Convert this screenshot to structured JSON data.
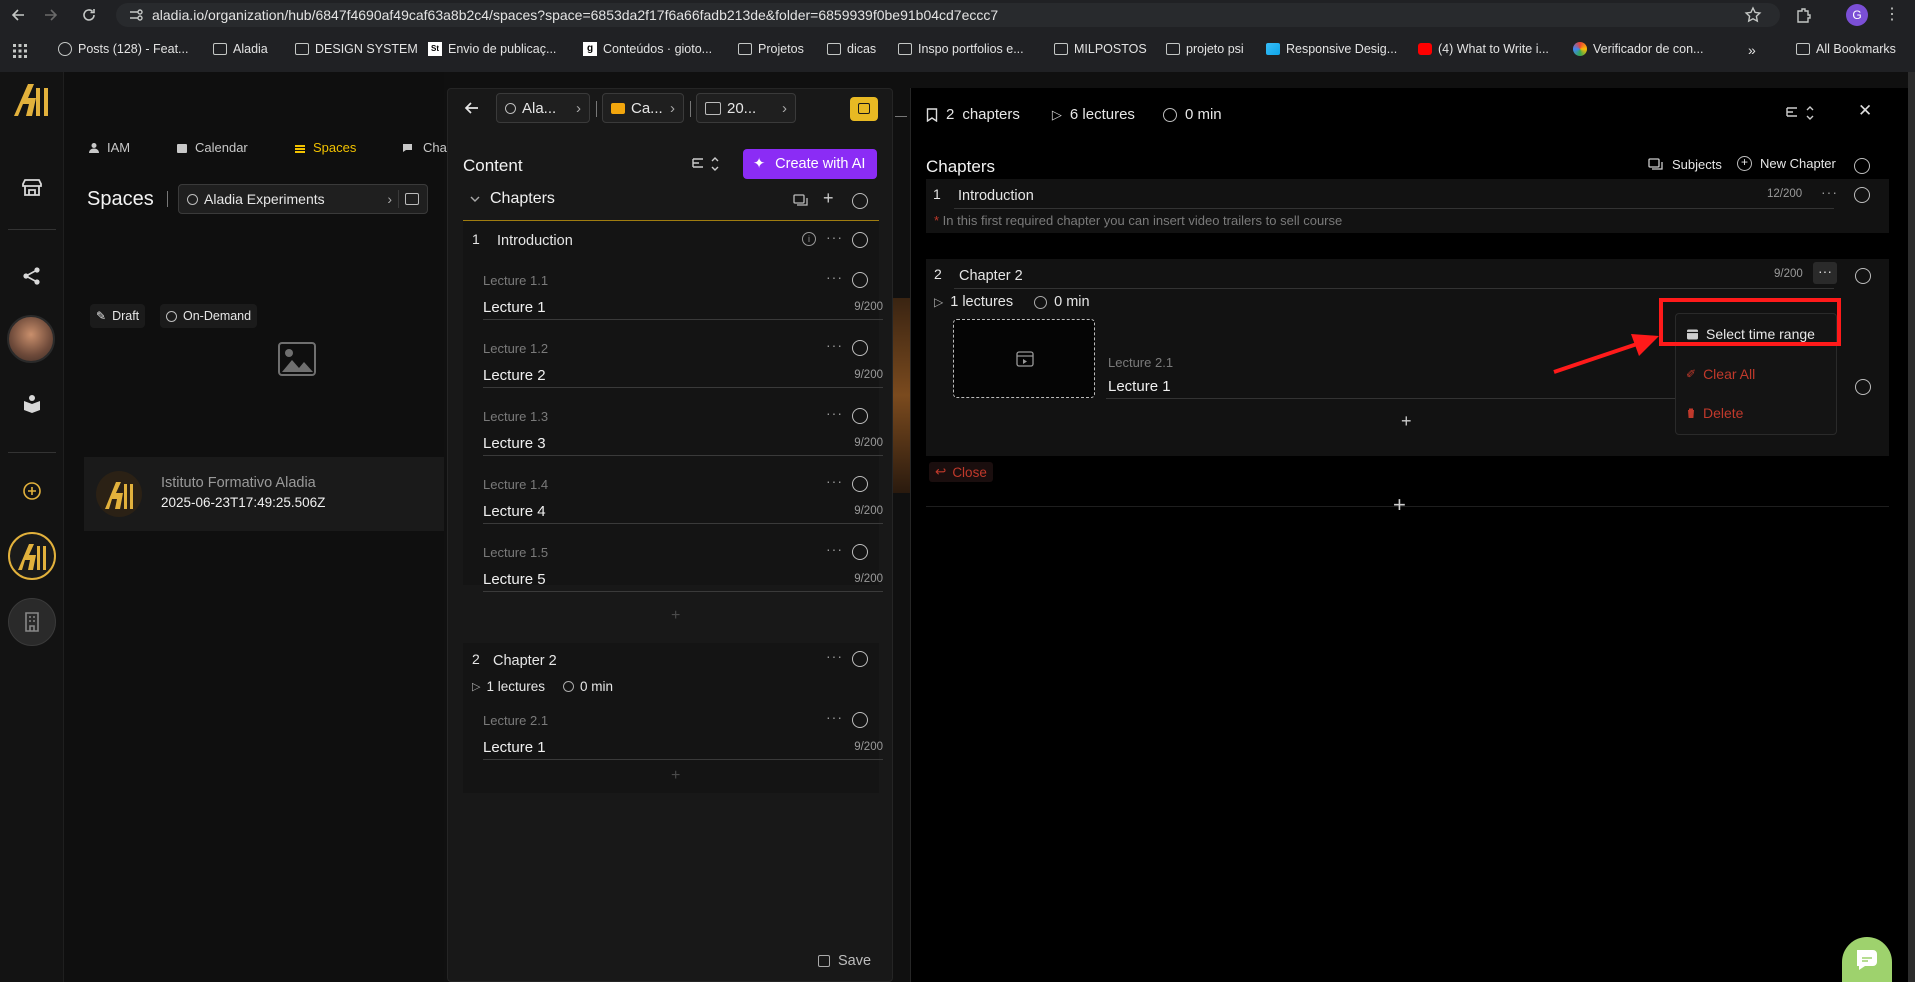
{
  "browser": {
    "url": "aladia.io/organization/hub/6847f4690af49caf63a8b2c4/spaces?space=6853da2f17f6a66fadb213de&folder=6859939f0be91b04cd7eccc7",
    "profile_initial": "G",
    "bookmarks": [
      {
        "label": "Posts (128) - Feat..."
      },
      {
        "label": "Aladia"
      },
      {
        "label": "DESIGN SYSTEM"
      },
      {
        "label": "Envio de publicaç..."
      },
      {
        "label": "Conteúdos · gioto..."
      },
      {
        "label": "Projetos"
      },
      {
        "label": "dicas"
      },
      {
        "label": "Inspo portfolios e..."
      },
      {
        "label": "MILPOSTOS"
      },
      {
        "label": "projeto psi"
      },
      {
        "label": "Responsive Desig..."
      },
      {
        "label": "(4) What to Write i..."
      },
      {
        "label": "Verificador de con..."
      }
    ],
    "more": "»",
    "all_bookmarks": "All Bookmarks"
  },
  "topnav": {
    "tabs": [
      "IAM",
      "Calendar",
      "Spaces",
      "Cha"
    ]
  },
  "spaces": {
    "title": "Spaces",
    "crumb": "Aladia Experiments",
    "badges": [
      "Draft",
      "On-Demand"
    ],
    "org_name": "Istituto Formativo Aladia",
    "org_date": "2025-06-23T17:49:25.506Z"
  },
  "content_panel": {
    "crumbs": [
      "Ala...",
      "Ca...",
      "20..."
    ],
    "title": "Content",
    "create_ai": "Create with AI",
    "chapters_label": "Chapters",
    "chapter1": {
      "num": "1",
      "name": "Introduction",
      "lectures": [
        {
          "sub": "Lecture 1.1",
          "title": "Lecture 1",
          "count": "9/200"
        },
        {
          "sub": "Lecture 1.2",
          "title": "Lecture 2",
          "count": "9/200"
        },
        {
          "sub": "Lecture 1.3",
          "title": "Lecture 3",
          "count": "9/200"
        },
        {
          "sub": "Lecture 1.4",
          "title": "Lecture 4",
          "count": "9/200"
        },
        {
          "sub": "Lecture 1.5",
          "title": "Lecture 5",
          "count": "9/200"
        }
      ]
    },
    "chapter2": {
      "num": "2",
      "name": "Chapter 2",
      "lectures_count": "1 lectures",
      "duration": "0 min",
      "lectures": [
        {
          "sub": "Lecture 2.1",
          "title": "Lecture 1",
          "count": "9/200"
        }
      ]
    },
    "save": "Save"
  },
  "right_panel": {
    "stats": {
      "chapters_num": "2",
      "chapters_label": "chapters",
      "lectures": "6 lectures",
      "duration": "0 min"
    },
    "title": "Chapters",
    "subjects": "Subjects",
    "new_chapter": "New Chapter",
    "chapter1": {
      "num": "1",
      "name": "Introduction",
      "count": "12/200",
      "note": "In this first required chapter you can insert video trailers to sell course"
    },
    "chapter2": {
      "num": "2",
      "name": "Chapter 2",
      "count": "9/200",
      "lectures_count": "1 lectures",
      "duration": "0 min",
      "lecture_sub": "Lecture 2.1",
      "lecture_title": "Lecture 1"
    },
    "close": "Close",
    "menu": {
      "select_time_range": "Select time range",
      "clear_all": "Clear All",
      "delete": "Delete"
    }
  },
  "colors": {
    "accent_gold": "#f2c200",
    "ai_purple": "#8b2cf5",
    "danger": "#c0392b",
    "highlight_red": "#ff1a1a"
  }
}
